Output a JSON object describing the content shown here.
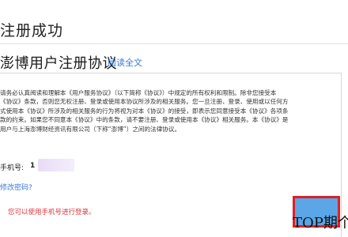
{
  "header": {
    "title": "注册成功"
  },
  "agreement": {
    "title": "澎博用户注册协议",
    "read_link": "阅读全文",
    "text": "请务必认真阅读和理解本《用户服务协议》（以下简称《协议》）中规定的所有权利和限制。除非您接受本\n《协议》条款，否则您无权注册、登录或使用本协议所涉及的相关服务。您一旦注册、登录、使用或以任何方\n式使用本《协议》所涉及的相关服务的行为将视为对本《协议》的接受，即表示您同意接受本《协议》各项条\n款的约束。如果您不同意本《协议》中的条款，请不要注册、登录或使用本《协议》相关服务。本《协议》是\n用户与上海澎博财经资讯有限公司（下称“澎博”）之间的法律协议。"
  },
  "account": {
    "phone_label": "手机号:",
    "phone_value": "1"
  },
  "links": {
    "forgot_password": "修改密码?"
  },
  "notice": {
    "login_note": "您可以使用手机号进行登录。"
  },
  "watermark": {
    "text": "TOP期个"
  },
  "colors": {
    "link": "#3a7bd5",
    "notice": "#d9363e",
    "highlight": "#e02020",
    "button": "#5aa6e6"
  }
}
